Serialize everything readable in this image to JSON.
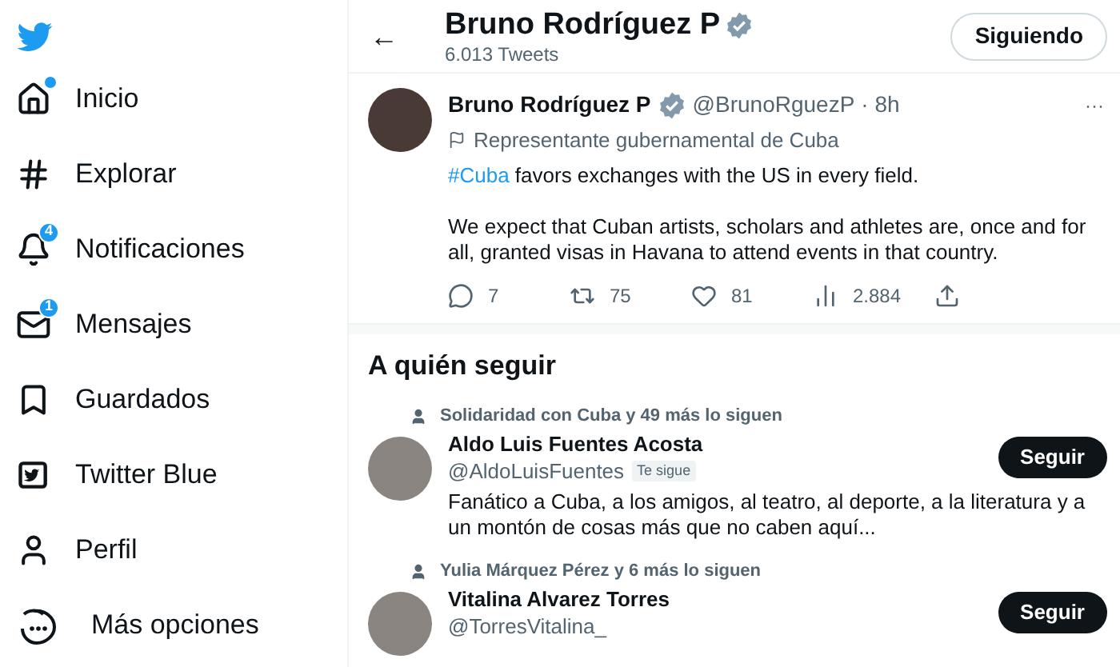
{
  "sidebar": {
    "items": [
      {
        "kind": "home",
        "label": "Inicio",
        "dot": true
      },
      {
        "kind": "hash",
        "label": "Explorar",
        "dot": false
      },
      {
        "kind": "bell",
        "label": "Notificaciones",
        "dot": false,
        "badge": "4"
      },
      {
        "kind": "mail",
        "label": "Mensajes",
        "dot": false,
        "badge": "1"
      },
      {
        "kind": "bookmark",
        "label": "Guardados",
        "dot": false
      },
      {
        "kind": "blue",
        "label": "Twitter Blue",
        "dot": false
      },
      {
        "kind": "person",
        "label": "Perfil",
        "dot": false
      },
      {
        "kind": "more",
        "label": "Más opciones",
        "dot": false
      }
    ]
  },
  "header": {
    "back": "←",
    "title": "Bruno Rodríguez P",
    "verified": true,
    "tweet_count": "6.013 Tweets",
    "follow_button": "Siguiendo"
  },
  "tweet": {
    "name": "Bruno Rodríguez P",
    "verified": true,
    "handle": "@BrunoRguezP",
    "time": "· 8h",
    "more": "···",
    "label": "Representante gubernamental de Cuba",
    "hashtag": "#Cuba",
    "text_rest": " favors exchanges with the US in every field.",
    "text_2": "We expect that Cuban artists, scholars and athletes are, once and for all, granted visas in Havana to attend events in that country.",
    "actions": [
      {
        "kind": "reply",
        "count": "7"
      },
      {
        "kind": "retweet",
        "count": "75"
      },
      {
        "kind": "like",
        "count": "81"
      },
      {
        "kind": "views",
        "count": "2.884"
      },
      {
        "kind": "share"
      }
    ]
  },
  "who_to_follow": {
    "title": "A quién seguir",
    "accounts": [
      {
        "context": "Solidaridad con Cuba y 49 más lo siguen",
        "name": "Aldo Luis Fuentes Acosta",
        "handle": "@AldoLuisFuentes",
        "follows_you": "Te sigue",
        "bio": "Fanático a Cuba, a los amigos, al teatro, al deporte, a la literatura y a un montón de cosas más que no caben aquí...",
        "button": "Seguir"
      },
      {
        "context": "Yulia Márquez Pérez y 6 más lo siguen",
        "name": "Vitalina Alvarez Torres",
        "handle": "@TorresVitalina_",
        "button": "Seguir"
      }
    ]
  }
}
